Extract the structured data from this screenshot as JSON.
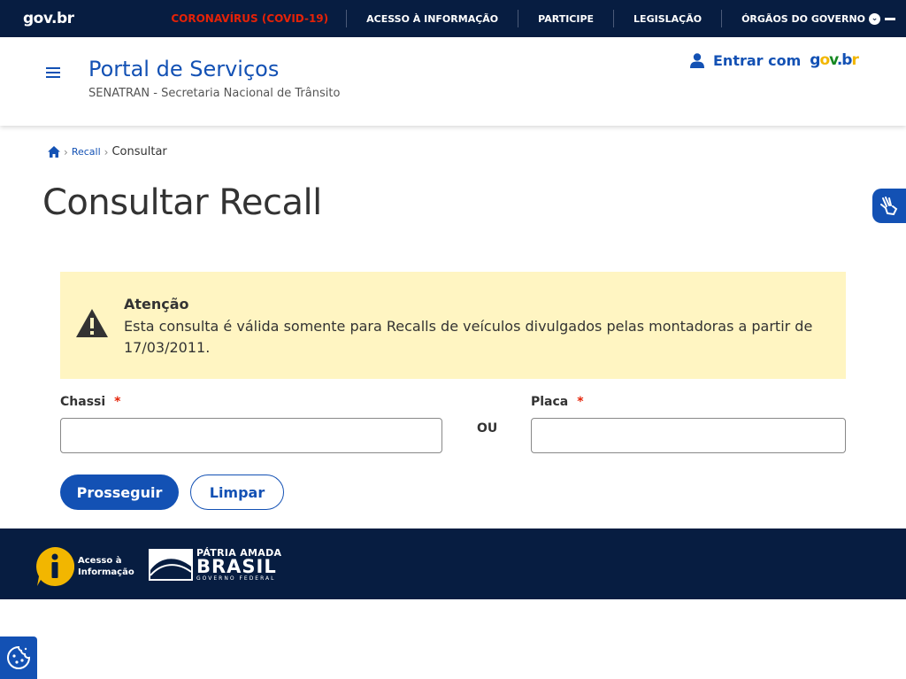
{
  "govbar": {
    "logo": "gov.br",
    "links": {
      "covid": "CORONAVÍRUS (COVID-19)",
      "acesso": "ACESSO À INFORMAÇÃO",
      "participe": "PARTICIPE",
      "legislacao": "LEGISLAÇÃO",
      "orgaos": "ÓRGÃOS DO GOVERNO"
    }
  },
  "header": {
    "title": "Portal de Serviços",
    "subtitle": "SENATRAN - Secretaria Nacional de Trânsito",
    "login_label": "Entrar com",
    "login_brand": "gov.br"
  },
  "breadcrumb": {
    "items": [
      "Recall"
    ],
    "current": "Consultar"
  },
  "page": {
    "title": "Consultar Recall"
  },
  "alert": {
    "title": "Atenção",
    "text": "Esta consulta é válida somente para Recalls de veículos divulgados pelas montadoras a partir de 17/03/2011."
  },
  "form": {
    "chassi_label": "Chassi",
    "chassi_value": "",
    "placa_label": "Placa",
    "placa_value": "",
    "required_mark": "*",
    "or_label": "OU",
    "submit_label": "Prosseguir",
    "clear_label": "Limpar"
  },
  "footer": {
    "acesso_line1": "Acesso à",
    "acesso_line2": "Informação",
    "patria_line1": "PÁTRIA AMADA",
    "patria_line2": "BRASIL",
    "patria_line3": "GOVERNO FEDERAL"
  },
  "colors": {
    "primary": "#1351b4",
    "dark_blue": "#071d41",
    "alert_bg": "#fff5c2",
    "danger": "#e52207"
  },
  "icons": [
    "menu-icon",
    "user-icon",
    "home-icon",
    "chevron-right-icon",
    "warning-icon",
    "libras-hand-icon",
    "info-icon",
    "cookie-icon",
    "chevron-down-icon"
  ]
}
